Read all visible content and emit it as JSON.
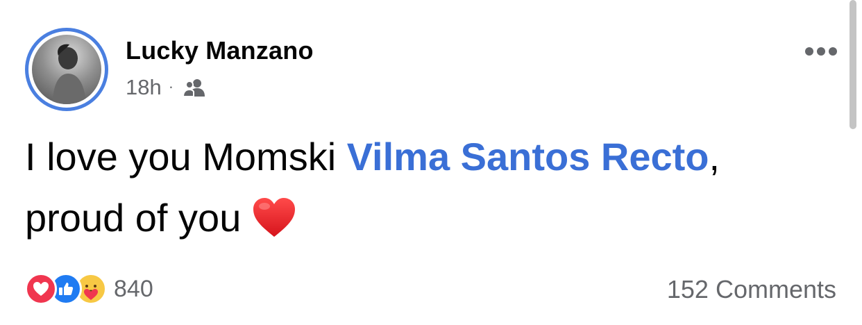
{
  "post": {
    "author": "Lucky Manzano",
    "time": "18h",
    "separator": "·",
    "audience_icon": "friends-icon",
    "text_before": "I love you Momski ",
    "mention": "Vilma Santos Recto",
    "text_after": ", proud of you",
    "emoji": "red-heart",
    "reaction_icons": [
      "love",
      "like",
      "care"
    ],
    "reaction_count": "840",
    "comments": "152 Comments"
  },
  "colors": {
    "mention": "#3a6fd6",
    "avatar_ring": "#4a7fe0",
    "meta": "#65676b",
    "love": "#f0364f",
    "like": "#1f7bf2",
    "care": "#f7c844"
  }
}
